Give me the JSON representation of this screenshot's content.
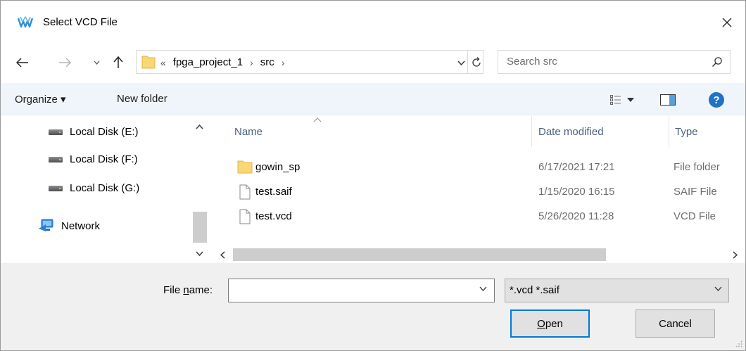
{
  "window": {
    "title": "Select VCD File",
    "logo_icon": "gowin-logo-icon",
    "accent_color": "#0078d7"
  },
  "address": {
    "overflow": "«",
    "crumbs": [
      "fpga_project_1",
      "src"
    ],
    "separator": "›"
  },
  "search": {
    "placeholder": "Search src"
  },
  "toolbar": {
    "organize_label": "Organize ▾",
    "new_folder_label": "New folder",
    "help_label": "?"
  },
  "navpane": {
    "items": [
      {
        "label": "Local Disk (E:)",
        "icon": "drive-icon"
      },
      {
        "label": "Local Disk (F:)",
        "icon": "drive-icon"
      },
      {
        "label": "Local Disk (G:)",
        "icon": "drive-icon"
      },
      {
        "label": "Network",
        "icon": "network-icon"
      }
    ]
  },
  "filelist": {
    "columns": {
      "name": "Name",
      "date": "Date modified",
      "type": "Type"
    },
    "rows": [
      {
        "name": "gowin_sp",
        "date": "6/17/2021 17:21",
        "type": "File folder",
        "icon": "folder-icon"
      },
      {
        "name": "test.saif",
        "date": "1/15/2020 16:15",
        "type": "SAIF File",
        "icon": "file-icon"
      },
      {
        "name": "test.vcd",
        "date": "5/26/2020 11:28",
        "type": "VCD File",
        "icon": "file-icon"
      }
    ]
  },
  "bottom": {
    "file_name_prefix": "File ",
    "file_name_hotkey": "n",
    "file_name_suffix": "ame:",
    "file_name_value": "",
    "filter_value": "*.vcd *.saif",
    "open_hotkey": "O",
    "open_rest": "pen",
    "cancel_label": "Cancel"
  }
}
